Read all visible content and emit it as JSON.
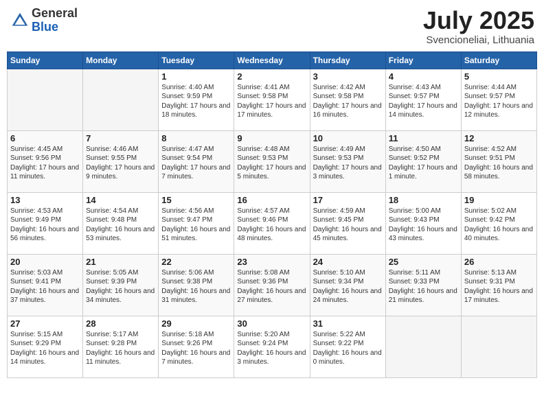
{
  "header": {
    "logo_general": "General",
    "logo_blue": "Blue",
    "month_title": "July 2025",
    "location": "Svencioneliai, Lithuania"
  },
  "weekdays": [
    "Sunday",
    "Monday",
    "Tuesday",
    "Wednesday",
    "Thursday",
    "Friday",
    "Saturday"
  ],
  "weeks": [
    [
      {
        "day": "",
        "empty": true
      },
      {
        "day": "",
        "empty": true
      },
      {
        "day": "1",
        "sunrise": "Sunrise: 4:40 AM",
        "sunset": "Sunset: 9:59 PM",
        "daylight": "Daylight: 17 hours and 18 minutes."
      },
      {
        "day": "2",
        "sunrise": "Sunrise: 4:41 AM",
        "sunset": "Sunset: 9:58 PM",
        "daylight": "Daylight: 17 hours and 17 minutes."
      },
      {
        "day": "3",
        "sunrise": "Sunrise: 4:42 AM",
        "sunset": "Sunset: 9:58 PM",
        "daylight": "Daylight: 17 hours and 16 minutes."
      },
      {
        "day": "4",
        "sunrise": "Sunrise: 4:43 AM",
        "sunset": "Sunset: 9:57 PM",
        "daylight": "Daylight: 17 hours and 14 minutes."
      },
      {
        "day": "5",
        "sunrise": "Sunrise: 4:44 AM",
        "sunset": "Sunset: 9:57 PM",
        "daylight": "Daylight: 17 hours and 12 minutes."
      }
    ],
    [
      {
        "day": "6",
        "sunrise": "Sunrise: 4:45 AM",
        "sunset": "Sunset: 9:56 PM",
        "daylight": "Daylight: 17 hours and 11 minutes."
      },
      {
        "day": "7",
        "sunrise": "Sunrise: 4:46 AM",
        "sunset": "Sunset: 9:55 PM",
        "daylight": "Daylight: 17 hours and 9 minutes."
      },
      {
        "day": "8",
        "sunrise": "Sunrise: 4:47 AM",
        "sunset": "Sunset: 9:54 PM",
        "daylight": "Daylight: 17 hours and 7 minutes."
      },
      {
        "day": "9",
        "sunrise": "Sunrise: 4:48 AM",
        "sunset": "Sunset: 9:53 PM",
        "daylight": "Daylight: 17 hours and 5 minutes."
      },
      {
        "day": "10",
        "sunrise": "Sunrise: 4:49 AM",
        "sunset": "Sunset: 9:53 PM",
        "daylight": "Daylight: 17 hours and 3 minutes."
      },
      {
        "day": "11",
        "sunrise": "Sunrise: 4:50 AM",
        "sunset": "Sunset: 9:52 PM",
        "daylight": "Daylight: 17 hours and 1 minute."
      },
      {
        "day": "12",
        "sunrise": "Sunrise: 4:52 AM",
        "sunset": "Sunset: 9:51 PM",
        "daylight": "Daylight: 16 hours and 58 minutes."
      }
    ],
    [
      {
        "day": "13",
        "sunrise": "Sunrise: 4:53 AM",
        "sunset": "Sunset: 9:49 PM",
        "daylight": "Daylight: 16 hours and 56 minutes."
      },
      {
        "day": "14",
        "sunrise": "Sunrise: 4:54 AM",
        "sunset": "Sunset: 9:48 PM",
        "daylight": "Daylight: 16 hours and 53 minutes."
      },
      {
        "day": "15",
        "sunrise": "Sunrise: 4:56 AM",
        "sunset": "Sunset: 9:47 PM",
        "daylight": "Daylight: 16 hours and 51 minutes."
      },
      {
        "day": "16",
        "sunrise": "Sunrise: 4:57 AM",
        "sunset": "Sunset: 9:46 PM",
        "daylight": "Daylight: 16 hours and 48 minutes."
      },
      {
        "day": "17",
        "sunrise": "Sunrise: 4:59 AM",
        "sunset": "Sunset: 9:45 PM",
        "daylight": "Daylight: 16 hours and 45 minutes."
      },
      {
        "day": "18",
        "sunrise": "Sunrise: 5:00 AM",
        "sunset": "Sunset: 9:43 PM",
        "daylight": "Daylight: 16 hours and 43 minutes."
      },
      {
        "day": "19",
        "sunrise": "Sunrise: 5:02 AM",
        "sunset": "Sunset: 9:42 PM",
        "daylight": "Daylight: 16 hours and 40 minutes."
      }
    ],
    [
      {
        "day": "20",
        "sunrise": "Sunrise: 5:03 AM",
        "sunset": "Sunset: 9:41 PM",
        "daylight": "Daylight: 16 hours and 37 minutes."
      },
      {
        "day": "21",
        "sunrise": "Sunrise: 5:05 AM",
        "sunset": "Sunset: 9:39 PM",
        "daylight": "Daylight: 16 hours and 34 minutes."
      },
      {
        "day": "22",
        "sunrise": "Sunrise: 5:06 AM",
        "sunset": "Sunset: 9:38 PM",
        "daylight": "Daylight: 16 hours and 31 minutes."
      },
      {
        "day": "23",
        "sunrise": "Sunrise: 5:08 AM",
        "sunset": "Sunset: 9:36 PM",
        "daylight": "Daylight: 16 hours and 27 minutes."
      },
      {
        "day": "24",
        "sunrise": "Sunrise: 5:10 AM",
        "sunset": "Sunset: 9:34 PM",
        "daylight": "Daylight: 16 hours and 24 minutes."
      },
      {
        "day": "25",
        "sunrise": "Sunrise: 5:11 AM",
        "sunset": "Sunset: 9:33 PM",
        "daylight": "Daylight: 16 hours and 21 minutes."
      },
      {
        "day": "26",
        "sunrise": "Sunrise: 5:13 AM",
        "sunset": "Sunset: 9:31 PM",
        "daylight": "Daylight: 16 hours and 17 minutes."
      }
    ],
    [
      {
        "day": "27",
        "sunrise": "Sunrise: 5:15 AM",
        "sunset": "Sunset: 9:29 PM",
        "daylight": "Daylight: 16 hours and 14 minutes."
      },
      {
        "day": "28",
        "sunrise": "Sunrise: 5:17 AM",
        "sunset": "Sunset: 9:28 PM",
        "daylight": "Daylight: 16 hours and 11 minutes."
      },
      {
        "day": "29",
        "sunrise": "Sunrise: 5:18 AM",
        "sunset": "Sunset: 9:26 PM",
        "daylight": "Daylight: 16 hours and 7 minutes."
      },
      {
        "day": "30",
        "sunrise": "Sunrise: 5:20 AM",
        "sunset": "Sunset: 9:24 PM",
        "daylight": "Daylight: 16 hours and 3 minutes."
      },
      {
        "day": "31",
        "sunrise": "Sunrise: 5:22 AM",
        "sunset": "Sunset: 9:22 PM",
        "daylight": "Daylight: 16 hours and 0 minutes."
      },
      {
        "day": "",
        "empty": true
      },
      {
        "day": "",
        "empty": true
      }
    ]
  ]
}
